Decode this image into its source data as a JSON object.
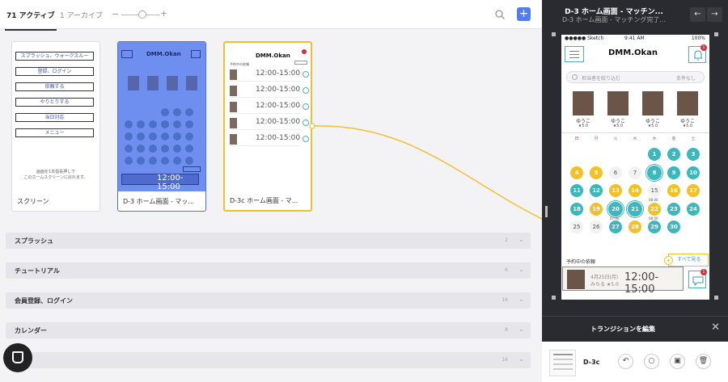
{
  "topbar": {
    "tab_active": "71 アクティブ",
    "tab_archive": "1 アーカイブ",
    "zoom_minus": "−",
    "zoom_plus": "+",
    "add_label": "+"
  },
  "cards": [
    {
      "label": "スクリーン"
    },
    {
      "label": "D-3 ホーム画面 - マッ..."
    },
    {
      "label": "D-3c ホーム画面 - マ..."
    }
  ],
  "splash_menu": [
    "スプラッシュ、ウォークスルー",
    "登録、ログイン",
    "依頼する",
    "やりとりする",
    "当日対応",
    "メニュー"
  ],
  "splash_note": "画面を1本指長押しで\nこのホームスクリーンに戻れます。",
  "sections": [
    {
      "name": "スプラッシュ",
      "count": "2"
    },
    {
      "name": "チュートリアル",
      "count": "6"
    },
    {
      "name": "会員登録、ログイン",
      "count": "16"
    },
    {
      "name": "カレンダー",
      "count": "8"
    },
    {
      "name": "",
      "count": "16"
    }
  ],
  "right_panel": {
    "title": "D-3 ホーム画面 - マッチン...",
    "subtitle": "D-3 ホーム画面 - マッチング完了...",
    "nav_back": "←",
    "nav_forward": "→",
    "transition_label": "トランジションを編集",
    "close": "✕",
    "target_name": "D-3c"
  },
  "phone": {
    "carrier": "●●●●● Sketch",
    "time": "9:41 AM",
    "battery": "100%",
    "logo": "DMM.Okan",
    "bell_badge": "1",
    "search_placeholder": "担当者を絞り込む",
    "search_filter": "条件なし",
    "therapists": [
      {
        "name": "ゆうこ",
        "rating": "★5.0"
      },
      {
        "name": "ゆうこ",
        "rating": "★5.0"
      },
      {
        "name": "ゆうこ",
        "rating": "★5.0"
      },
      {
        "name": "ゆうこ",
        "rating": "★5.0"
      }
    ],
    "weekdays": [
      "日",
      "月",
      "火",
      "水",
      "木",
      "金",
      "土"
    ],
    "booked_label": "予約中の依頼",
    "see_all": "すべて見る",
    "booking": {
      "date": "4月25日(月)",
      "name": "みちる ★5.0",
      "time": "12:00-15:00",
      "badge": "1"
    }
  },
  "card3_rows": [
    {
      "time": "12:00-15:00"
    },
    {
      "time": "12:00-15:00"
    },
    {
      "time": "12:00-15:00"
    },
    {
      "time": "12:00-15:00"
    },
    {
      "time": "12:00-15:00"
    }
  ],
  "calendar_days": [
    {
      "d": "1",
      "c": "t"
    },
    {
      "d": "2",
      "c": "t"
    },
    {
      "d": "3",
      "c": "t"
    },
    {
      "d": "4",
      "c": "y"
    },
    {
      "d": "5",
      "c": "y"
    },
    {
      "d": "6",
      "c": "g"
    },
    {
      "d": "7",
      "c": "g"
    },
    {
      "d": "8",
      "c": "t sel"
    },
    {
      "d": "9",
      "c": "t"
    },
    {
      "d": "10",
      "c": "t"
    },
    {
      "d": "11",
      "c": "t"
    },
    {
      "d": "12",
      "c": "t"
    },
    {
      "d": "13",
      "c": "y"
    },
    {
      "d": "14",
      "c": "y"
    },
    {
      "d": "15",
      "c": "g"
    },
    {
      "d": "16",
      "c": "y"
    },
    {
      "d": "17",
      "c": "y"
    },
    {
      "d": "18",
      "c": "t"
    },
    {
      "d": "19",
      "c": "y"
    },
    {
      "d": "20",
      "c": "t sel"
    },
    {
      "d": "21",
      "c": "t sel"
    },
    {
      "d": "22",
      "c": "y"
    },
    {
      "d": "23",
      "c": "t"
    },
    {
      "d": "24",
      "c": "t"
    },
    {
      "d": "25",
      "c": "g"
    },
    {
      "d": "26",
      "c": "g"
    },
    {
      "d": "27",
      "c": "t"
    },
    {
      "d": "28",
      "c": "y"
    },
    {
      "d": "29",
      "c": "t"
    },
    {
      "d": "30",
      "c": "t"
    }
  ],
  "day_times": {
    "15": "08:00",
    "20": "07:00",
    "22": "08:00"
  }
}
